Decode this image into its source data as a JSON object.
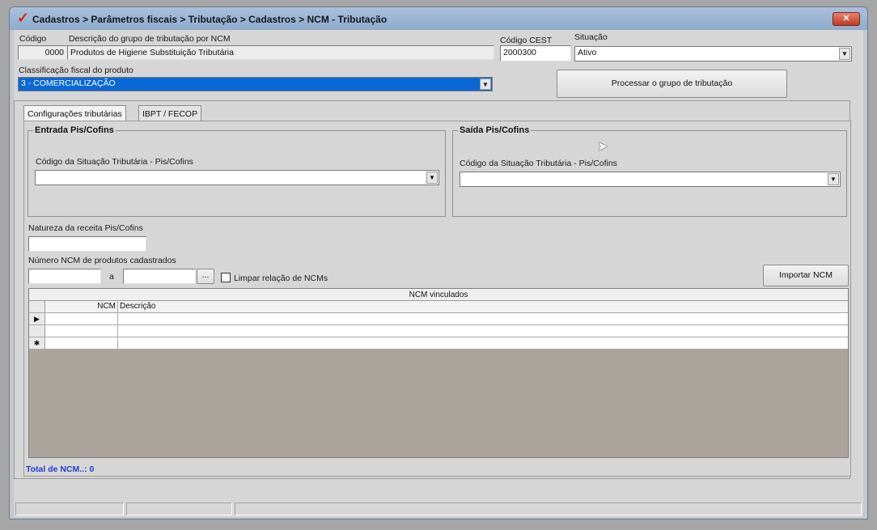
{
  "window": {
    "title": "Cadastros > Parâmetros fiscais > Tributação > Cadastros > NCM - Tributação",
    "close_label": "✕"
  },
  "header": {
    "codigo_label": "Código",
    "codigo_value": "0000",
    "descricao_label": "Descrição do grupo de tributação por NCM",
    "descricao_value": "Produtos de Higiene Substituição Tributária",
    "cest_label": "Código CEST",
    "cest_value": "2000300",
    "situacao_label": "Situação",
    "situacao_value": "Ativo",
    "classificacao_label": "Classificação fiscal do produto",
    "classificacao_value": "3 - COMERCIALIZAÇÃO",
    "processar_label": "Processar o grupo de tributação"
  },
  "tabs": [
    {
      "label": "Configurações tributárias",
      "active": true
    },
    {
      "label": "IBPT / FECOP",
      "active": false
    }
  ],
  "entrada": {
    "title": "Entrada Pis/Cofins",
    "cst_label": "Código da Situação Tributária - Pis/Cofins",
    "cst_value": ""
  },
  "saida": {
    "title": "Saída Pis/Cofins",
    "cst_label": "Código da Situação Tributária - Pis/Cofins",
    "cst_value": ""
  },
  "natureza": {
    "label": "Natureza da receita Pis/Cofins",
    "value": ""
  },
  "ncm_range": {
    "label": "Número  NCM de produtos cadastrados",
    "from": "",
    "sep": "a",
    "to": "",
    "browse_label": "...",
    "limpar_label": "Limpar relação de NCMs",
    "importar_label": "Importar NCM"
  },
  "grid": {
    "caption": "NCM vinculados",
    "columns": [
      "NCM",
      "Descrição"
    ],
    "rows": [
      {
        "indicator": "▶",
        "ncm": "",
        "descricao": ""
      },
      {
        "indicator": "",
        "ncm": "",
        "descricao": ""
      },
      {
        "indicator": "✱",
        "ncm": "",
        "descricao": ""
      }
    ]
  },
  "footer": {
    "total_label": "Total de NCM..: 0"
  },
  "colors": {
    "accent_selected": "#0a67d6",
    "total_text": "#1f3fd1"
  }
}
